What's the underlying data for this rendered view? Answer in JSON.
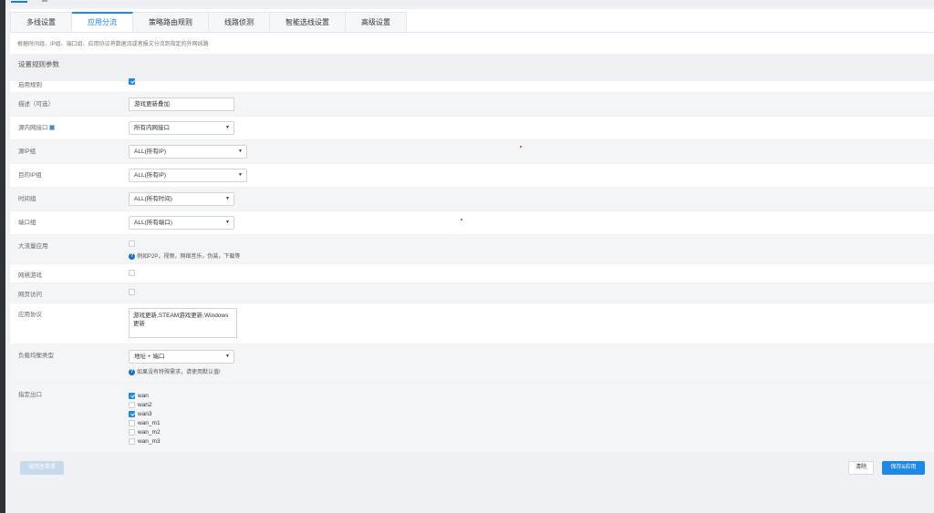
{
  "tabs": [
    {
      "label": "多线设置"
    },
    {
      "label": "应用分流"
    },
    {
      "label": "策略路由规则"
    },
    {
      "label": "线路侦测"
    },
    {
      "label": "智能选线设置"
    },
    {
      "label": "高级设置"
    }
  ],
  "active_tab": "应用分流",
  "description": "根据时间组、IP组、端口组、应用协议将数据流或者报文分流到指定的外网线路",
  "section_title": "设置规则参数",
  "form": {
    "enable_rule": {
      "label": "启用规则",
      "checked": true
    },
    "remark": {
      "label": "描述（可选）",
      "value": "游戏更新叠加"
    },
    "source_interface": {
      "label": "源内网接口",
      "value": "所有内网接口",
      "icon": "info-icon"
    },
    "source_ip_group": {
      "label": "源IP组",
      "value": "ALL(所有IP)"
    },
    "dest_ip_group": {
      "label": "目的IP组",
      "value": "ALL(所有IP)"
    },
    "time_group": {
      "label": "时间组",
      "value": "ALL(所有时间)"
    },
    "port_group": {
      "label": "端口组",
      "value": "ALL(所有端口)"
    },
    "heavy_traffic": {
      "label": "大流量应用",
      "checked": false,
      "hint": "例如P2P，视频，网络音乐，伪装，下载等"
    },
    "online_game": {
      "label": "网络游戏",
      "checked": false
    },
    "web_access": {
      "label": "网页访问",
      "checked": false
    },
    "app_protocol": {
      "label": "应用协议",
      "value": "游戏更新,STEAM游戏更新,Windows更新"
    },
    "load_balance": {
      "label": "负载均衡类型",
      "value": "地址 + 端口",
      "hint": "如果没有特殊需求，请使用默认值!"
    },
    "egress": {
      "label": "指定出口",
      "options": [
        {
          "name": "wan",
          "checked": true
        },
        {
          "name": "wan2",
          "checked": false
        },
        {
          "name": "wan3",
          "checked": true
        },
        {
          "name": "wan_m1",
          "checked": false
        },
        {
          "name": "wan_m2",
          "checked": false
        },
        {
          "name": "wan_m3",
          "checked": false
        }
      ]
    }
  },
  "footer": {
    "disabled_btn": "返回主菜单",
    "clear_btn": "清除",
    "save_btn": "保存&应用"
  },
  "colors": {
    "accent": "#1e88e5",
    "sidebar": "#2f3338",
    "alert_dot": "#e02020"
  }
}
